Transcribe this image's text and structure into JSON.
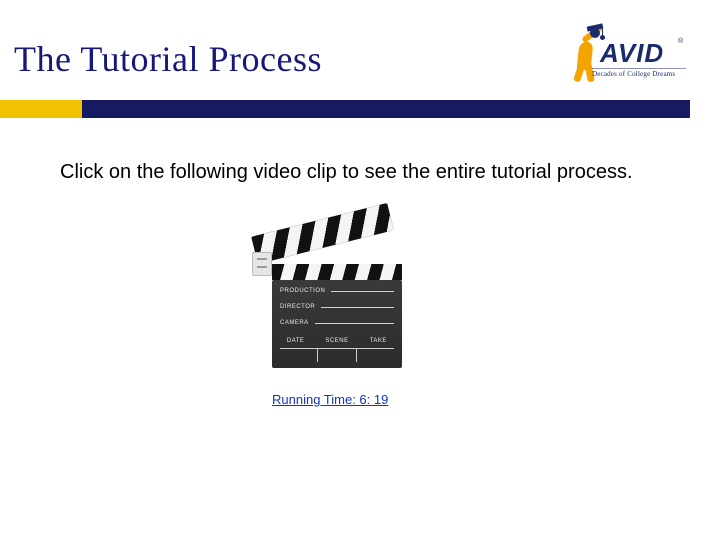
{
  "title": "The Tutorial Process",
  "body_text": "Click on the following video clip to see the entire tutorial process.",
  "video_link": {
    "runtime_label": "Running Time:  6: 19"
  },
  "clapper": {
    "row1": "PRODUCTION",
    "row2": "DIRECTOR",
    "row3": "CAMERA",
    "col1": "DATE",
    "col2": "SCENE",
    "col3": "TAKE"
  },
  "logo": {
    "brand": "AVID",
    "registered": "®",
    "tagline": "Decades of College Dreams"
  },
  "colors": {
    "navy": "#161b61",
    "yellow": "#f2c200",
    "link": "#1236c2",
    "orange": "#f5a300"
  }
}
